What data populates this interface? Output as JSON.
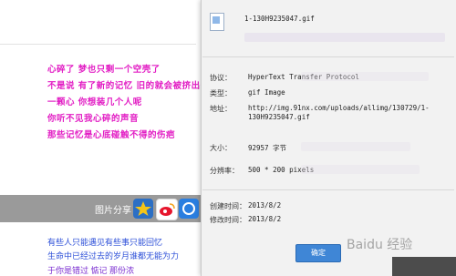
{
  "background": {
    "lines": [
      "心碎了 梦也只剩一个空壳了",
      "不是说 有了新的记忆 旧的就会被挤出去",
      "一颗心 你想装几个人呢",
      "你听不见我心碎的声音",
      "那些记忆是心底碰触不得的伤疤"
    ],
    "share_label": "图片分享",
    "bottom_lines": [
      "有些人只能遇见有些事只能回忆",
      "生命中已经过去的岁月谁都无能为力",
      "于你是错过 惦记 那份浓"
    ]
  },
  "dialog": {
    "filename": "1-130H9235047.gif",
    "rows": [
      {
        "label": "协议：",
        "value": "HyperText Transfer Protocol"
      },
      {
        "label": "类型：",
        "value": "gif Image"
      },
      {
        "label": "地址：",
        "value": "http://img.91nx.com/uploads/allimg/130729/1-"
      },
      {
        "label": "",
        "value": "130H9235047.gif"
      },
      {
        "label": "大小：",
        "value": "92957 字节"
      },
      {
        "label": "分辨率：",
        "value": "500 * 200 pixels"
      },
      {
        "label": "创建时间：",
        "value": "2013/8/2"
      },
      {
        "label": "修改时间：",
        "value": "2013/8/2"
      }
    ],
    "ok_label": "确定"
  },
  "watermark": "Baidu 经验"
}
